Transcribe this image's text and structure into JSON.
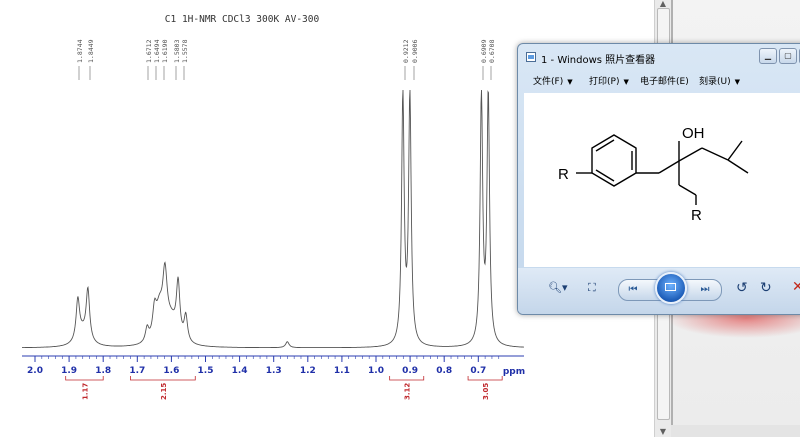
{
  "nmr": {
    "header": "C1 1H-NMR CDCl3 300K AV-300",
    "peak_labels": [
      "1.8744",
      "1.8449",
      "1.6712",
      "1.6494",
      "1.6190",
      "1.5803",
      "1.5578",
      "0.9212",
      "0.9006",
      "0.6909",
      "0.6708"
    ],
    "axis_ticks": [
      "2.0",
      "1.9",
      "1.8",
      "1.7",
      "1.6",
      "1.5",
      "1.4",
      "1.3",
      "1.2",
      "1.1",
      "1.0",
      "0.9",
      "0.8",
      "0.7"
    ],
    "axis_unit": "ppm",
    "integrals": [
      "1.17",
      "2.15",
      "3.12",
      "3.05"
    ]
  },
  "viewer": {
    "title": "1 - Windows 照片查看器",
    "menus": [
      "文件(F)",
      "打印(P)",
      "电子邮件(E)",
      "刻录(U)"
    ],
    "structure_labels": {
      "oh": "OH",
      "r_left": "R",
      "r_bottom": "R"
    },
    "accent": "#1d5db8"
  }
}
